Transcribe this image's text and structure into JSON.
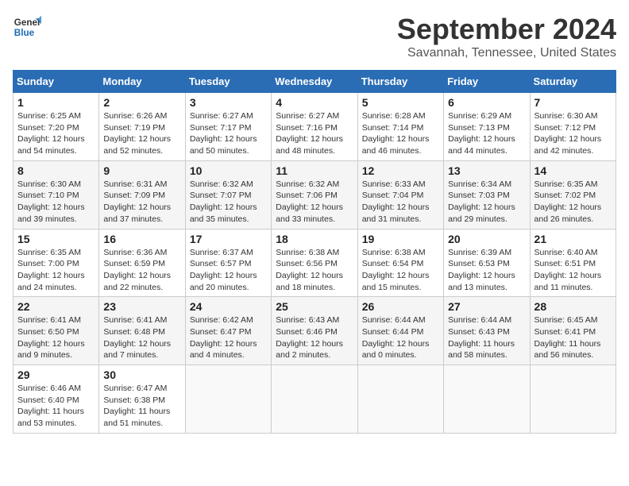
{
  "logo": {
    "line1": "General",
    "line2": "Blue"
  },
  "title": "September 2024",
  "subtitle": "Savannah, Tennessee, United States",
  "days_header": [
    "Sunday",
    "Monday",
    "Tuesday",
    "Wednesday",
    "Thursday",
    "Friday",
    "Saturday"
  ],
  "weeks": [
    [
      {
        "day": "1",
        "sunrise": "Sunrise: 6:25 AM",
        "sunset": "Sunset: 7:20 PM",
        "daylight": "Daylight: 12 hours and 54 minutes."
      },
      {
        "day": "2",
        "sunrise": "Sunrise: 6:26 AM",
        "sunset": "Sunset: 7:19 PM",
        "daylight": "Daylight: 12 hours and 52 minutes."
      },
      {
        "day": "3",
        "sunrise": "Sunrise: 6:27 AM",
        "sunset": "Sunset: 7:17 PM",
        "daylight": "Daylight: 12 hours and 50 minutes."
      },
      {
        "day": "4",
        "sunrise": "Sunrise: 6:27 AM",
        "sunset": "Sunset: 7:16 PM",
        "daylight": "Daylight: 12 hours and 48 minutes."
      },
      {
        "day": "5",
        "sunrise": "Sunrise: 6:28 AM",
        "sunset": "Sunset: 7:14 PM",
        "daylight": "Daylight: 12 hours and 46 minutes."
      },
      {
        "day": "6",
        "sunrise": "Sunrise: 6:29 AM",
        "sunset": "Sunset: 7:13 PM",
        "daylight": "Daylight: 12 hours and 44 minutes."
      },
      {
        "day": "7",
        "sunrise": "Sunrise: 6:30 AM",
        "sunset": "Sunset: 7:12 PM",
        "daylight": "Daylight: 12 hours and 42 minutes."
      }
    ],
    [
      {
        "day": "8",
        "sunrise": "Sunrise: 6:30 AM",
        "sunset": "Sunset: 7:10 PM",
        "daylight": "Daylight: 12 hours and 39 minutes."
      },
      {
        "day": "9",
        "sunrise": "Sunrise: 6:31 AM",
        "sunset": "Sunset: 7:09 PM",
        "daylight": "Daylight: 12 hours and 37 minutes."
      },
      {
        "day": "10",
        "sunrise": "Sunrise: 6:32 AM",
        "sunset": "Sunset: 7:07 PM",
        "daylight": "Daylight: 12 hours and 35 minutes."
      },
      {
        "day": "11",
        "sunrise": "Sunrise: 6:32 AM",
        "sunset": "Sunset: 7:06 PM",
        "daylight": "Daylight: 12 hours and 33 minutes."
      },
      {
        "day": "12",
        "sunrise": "Sunrise: 6:33 AM",
        "sunset": "Sunset: 7:04 PM",
        "daylight": "Daylight: 12 hours and 31 minutes."
      },
      {
        "day": "13",
        "sunrise": "Sunrise: 6:34 AM",
        "sunset": "Sunset: 7:03 PM",
        "daylight": "Daylight: 12 hours and 29 minutes."
      },
      {
        "day": "14",
        "sunrise": "Sunrise: 6:35 AM",
        "sunset": "Sunset: 7:02 PM",
        "daylight": "Daylight: 12 hours and 26 minutes."
      }
    ],
    [
      {
        "day": "15",
        "sunrise": "Sunrise: 6:35 AM",
        "sunset": "Sunset: 7:00 PM",
        "daylight": "Daylight: 12 hours and 24 minutes."
      },
      {
        "day": "16",
        "sunrise": "Sunrise: 6:36 AM",
        "sunset": "Sunset: 6:59 PM",
        "daylight": "Daylight: 12 hours and 22 minutes."
      },
      {
        "day": "17",
        "sunrise": "Sunrise: 6:37 AM",
        "sunset": "Sunset: 6:57 PM",
        "daylight": "Daylight: 12 hours and 20 minutes."
      },
      {
        "day": "18",
        "sunrise": "Sunrise: 6:38 AM",
        "sunset": "Sunset: 6:56 PM",
        "daylight": "Daylight: 12 hours and 18 minutes."
      },
      {
        "day": "19",
        "sunrise": "Sunrise: 6:38 AM",
        "sunset": "Sunset: 6:54 PM",
        "daylight": "Daylight: 12 hours and 15 minutes."
      },
      {
        "day": "20",
        "sunrise": "Sunrise: 6:39 AM",
        "sunset": "Sunset: 6:53 PM",
        "daylight": "Daylight: 12 hours and 13 minutes."
      },
      {
        "day": "21",
        "sunrise": "Sunrise: 6:40 AM",
        "sunset": "Sunset: 6:51 PM",
        "daylight": "Daylight: 12 hours and 11 minutes."
      }
    ],
    [
      {
        "day": "22",
        "sunrise": "Sunrise: 6:41 AM",
        "sunset": "Sunset: 6:50 PM",
        "daylight": "Daylight: 12 hours and 9 minutes."
      },
      {
        "day": "23",
        "sunrise": "Sunrise: 6:41 AM",
        "sunset": "Sunset: 6:48 PM",
        "daylight": "Daylight: 12 hours and 7 minutes."
      },
      {
        "day": "24",
        "sunrise": "Sunrise: 6:42 AM",
        "sunset": "Sunset: 6:47 PM",
        "daylight": "Daylight: 12 hours and 4 minutes."
      },
      {
        "day": "25",
        "sunrise": "Sunrise: 6:43 AM",
        "sunset": "Sunset: 6:46 PM",
        "daylight": "Daylight: 12 hours and 2 minutes."
      },
      {
        "day": "26",
        "sunrise": "Sunrise: 6:44 AM",
        "sunset": "Sunset: 6:44 PM",
        "daylight": "Daylight: 12 hours and 0 minutes."
      },
      {
        "day": "27",
        "sunrise": "Sunrise: 6:44 AM",
        "sunset": "Sunset: 6:43 PM",
        "daylight": "Daylight: 11 hours and 58 minutes."
      },
      {
        "day": "28",
        "sunrise": "Sunrise: 6:45 AM",
        "sunset": "Sunset: 6:41 PM",
        "daylight": "Daylight: 11 hours and 56 minutes."
      }
    ],
    [
      {
        "day": "29",
        "sunrise": "Sunrise: 6:46 AM",
        "sunset": "Sunset: 6:40 PM",
        "daylight": "Daylight: 11 hours and 53 minutes."
      },
      {
        "day": "30",
        "sunrise": "Sunrise: 6:47 AM",
        "sunset": "Sunset: 6:38 PM",
        "daylight": "Daylight: 11 hours and 51 minutes."
      },
      null,
      null,
      null,
      null,
      null
    ]
  ]
}
